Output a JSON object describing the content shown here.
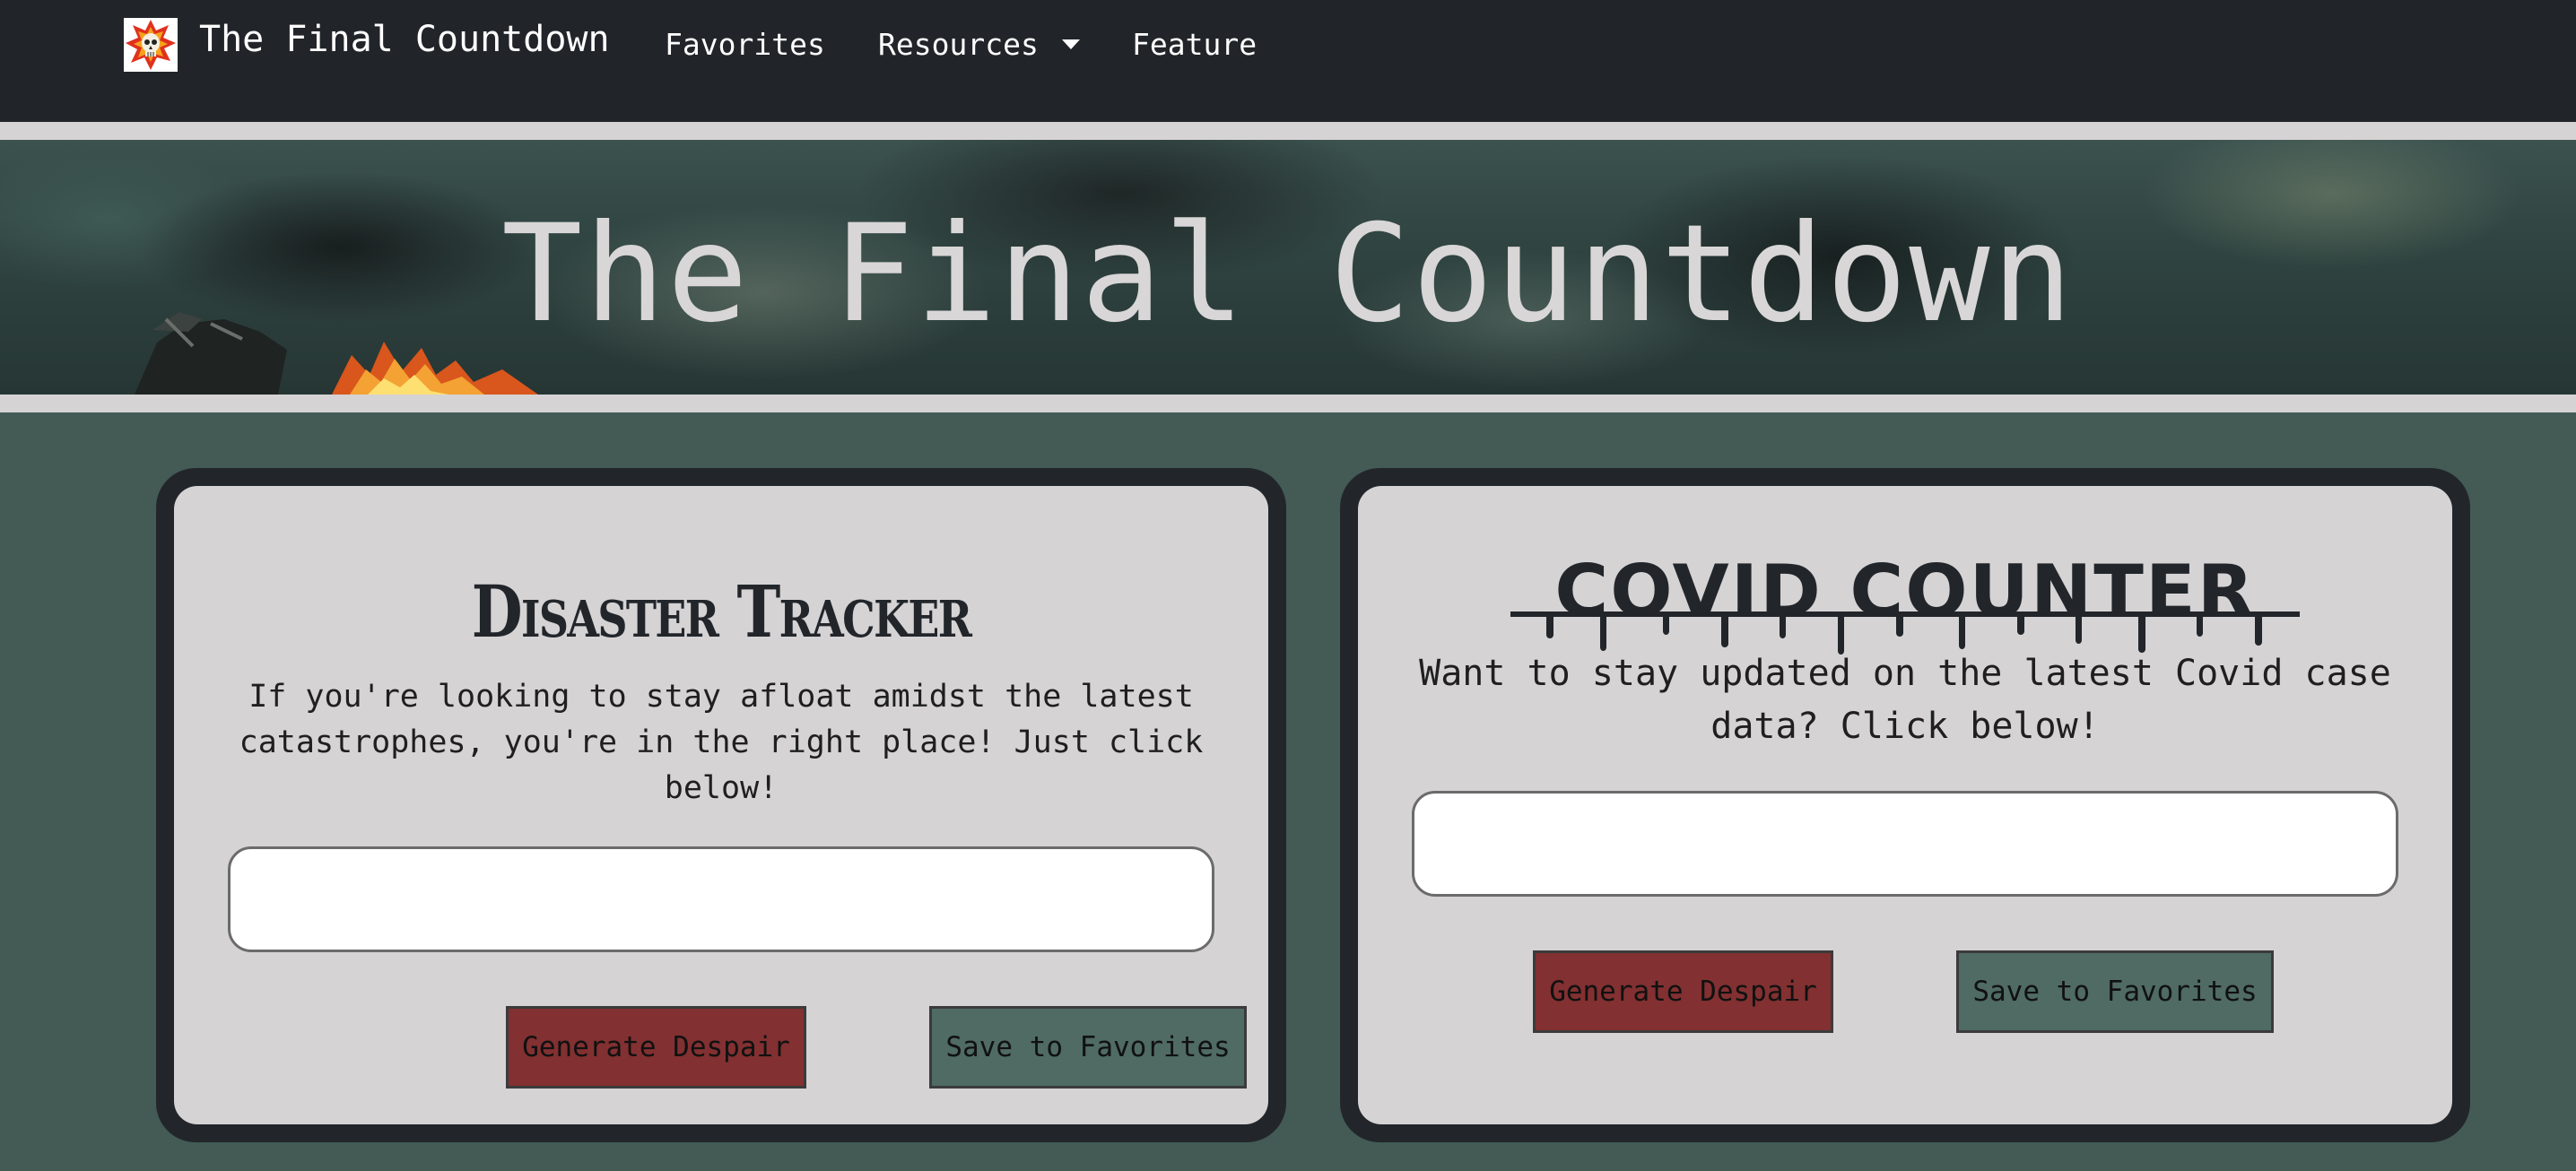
{
  "navbar": {
    "brand": "The Final Countdown",
    "links": {
      "favorites": "Favorites",
      "resources": "Resources",
      "feature": "Feature"
    },
    "logo_icon": "skull-explosion-icon"
  },
  "hero": {
    "title": "The Final Countdown"
  },
  "disaster_card": {
    "title": "Disaster Tracker",
    "description": "If you're looking to stay afloat amidst the latest catastrophes, you're in the right place! Just click below!",
    "input_value": "",
    "generate_label": "Generate Despair",
    "save_label": "Save to Favorites"
  },
  "covid_card": {
    "title": "COVID COUNTER",
    "description": "Want to stay updated on the latest Covid case data? Click below!",
    "input_value": "",
    "generate_label": "Generate Despair",
    "save_label": "Save to Favorites"
  },
  "colors": {
    "navbar": "#212529",
    "page_background": "#435b54",
    "card_frame": "#22262b",
    "card_body": "#d5d3d4",
    "despair_button": "#823031",
    "save_button": "#4f6b63"
  }
}
